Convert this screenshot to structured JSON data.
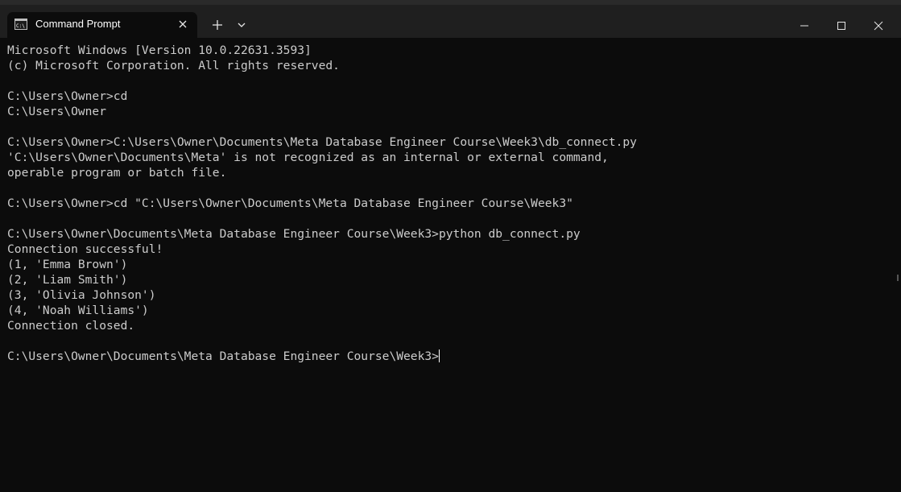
{
  "window": {
    "tab_title": "Command Prompt",
    "icons": {
      "tab": "command-prompt-icon",
      "close_tab": "close-icon",
      "new_tab": "plus-icon",
      "dropdown": "chevron-down-icon",
      "minimize": "minimize-icon",
      "maximize": "maximize-icon",
      "close_window": "close-icon"
    }
  },
  "colors": {
    "terminal_bg": "#0c0c0c",
    "titlebar_bg": "#1f1f1f",
    "text": "#cccccc"
  },
  "terminal": {
    "lines": [
      "Microsoft Windows [Version 10.0.22631.3593]",
      "(c) Microsoft Corporation. All rights reserved.",
      "",
      "C:\\Users\\Owner>cd",
      "C:\\Users\\Owner",
      "",
      "C:\\Users\\Owner>C:\\Users\\Owner\\Documents\\Meta Database Engineer Course\\Week3\\db_connect.py",
      "'C:\\Users\\Owner\\Documents\\Meta' is not recognized as an internal or external command,",
      "operable program or batch file.",
      "",
      "C:\\Users\\Owner>cd \"C:\\Users\\Owner\\Documents\\Meta Database Engineer Course\\Week3\"",
      "",
      "C:\\Users\\Owner\\Documents\\Meta Database Engineer Course\\Week3>python db_connect.py",
      "Connection successful!",
      "(1, 'Emma Brown')",
      "(2, 'Liam Smith')",
      "(3, 'Olivia Johnson')",
      "(4, 'Noah Williams')",
      "Connection closed.",
      "",
      "C:\\Users\\Owner\\Documents\\Meta Database Engineer Course\\Week3>"
    ]
  }
}
